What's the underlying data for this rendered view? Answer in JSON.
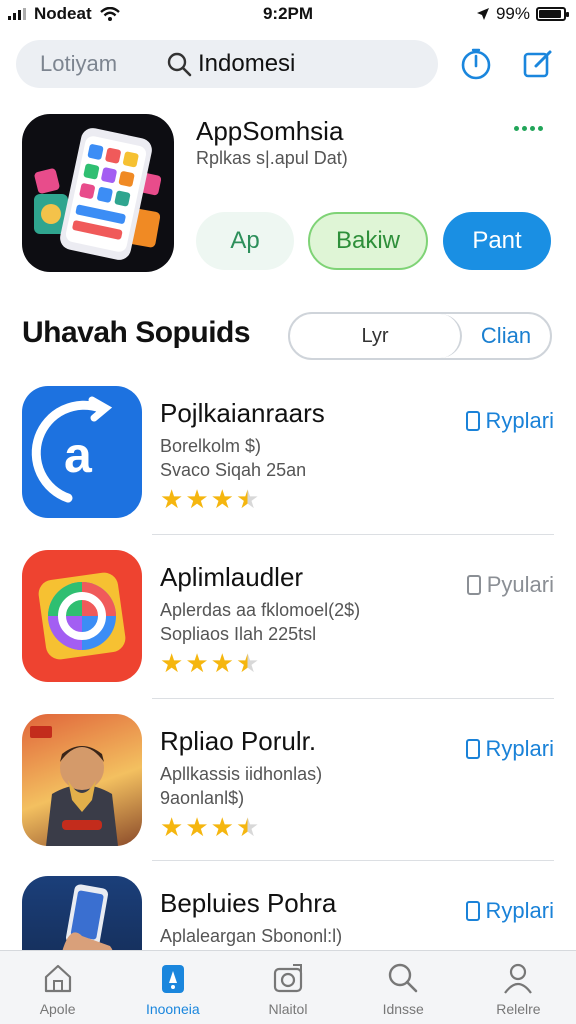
{
  "status_bar": {
    "carrier": "Nodeat",
    "time": "9:2PM",
    "battery": "99%",
    "battery_level": 0.9
  },
  "search": {
    "scope_label": "Lotiyam",
    "query": "Indomesi"
  },
  "header_icons": [
    "timer-icon",
    "compose-icon"
  ],
  "featured": {
    "title": "AppSomhsia",
    "subtitle": "Rplkas s|.apul Dat)",
    "buttons": {
      "app": "Ap",
      "baru": "Bakiw",
      "paint": "Pant"
    }
  },
  "section": {
    "title": "Uhavah Sopuids",
    "segment_left": "Lyr",
    "segment_right": "Clian"
  },
  "apps": [
    {
      "name": "Pojlkaianraars",
      "line1": "Borelkolm $)",
      "line2": "Svaco Siqah 25an",
      "rating": 3.5,
      "action": "Ryplari",
      "action_style": "blue"
    },
    {
      "name": "Aplimlaudler",
      "line1": "Aplerdas aa fklomoel(2$)",
      "line2": "Sopliaos Ilah 225tsl",
      "rating": 3.5,
      "action": "Pyulari",
      "action_style": "grey"
    },
    {
      "name": "Rpliao Porulr.",
      "line1": "Apllkassis iidhonlas)",
      "line2": "9aonlanl$)",
      "rating": 3.5,
      "action": "Ryplari",
      "action_style": "blue"
    },
    {
      "name": "Bepluies Pohra",
      "line1": "Aplaleargan Sbononl:l)",
      "line2": "",
      "rating": 0,
      "action": "Ryplari",
      "action_style": "blue"
    }
  ],
  "tabs": [
    {
      "label": "Apole",
      "icon": "home-icon",
      "active": false
    },
    {
      "label": "Inooneia",
      "icon": "apps-icon",
      "active": true
    },
    {
      "label": "Nlaitol",
      "icon": "camera-icon",
      "active": false
    },
    {
      "label": "Idnsse",
      "icon": "search-icon",
      "active": false
    },
    {
      "label": "Relelre",
      "icon": "person-icon",
      "active": false
    }
  ],
  "colors": {
    "accent": "#1a86dd",
    "star": "#f5b60f",
    "green": "#21a559"
  }
}
